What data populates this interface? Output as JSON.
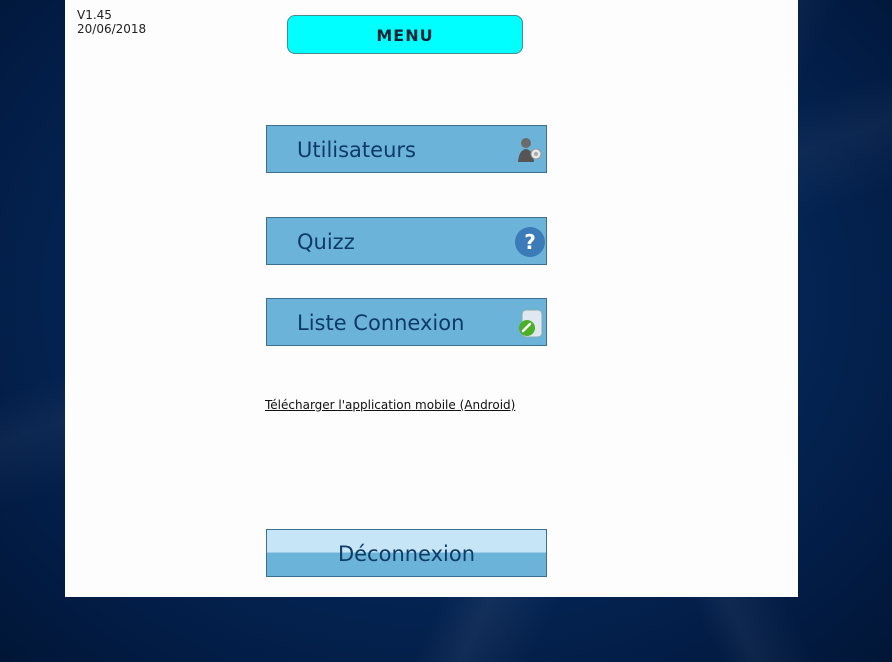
{
  "version": {
    "number": "V1.45",
    "date": "20/06/2018"
  },
  "header": {
    "title": "MENU"
  },
  "menu": {
    "items": [
      {
        "label": "Utilisateurs",
        "icon": "users-icon"
      },
      {
        "label": "Quizz",
        "icon": "question-icon"
      },
      {
        "label": "Liste Connexion",
        "icon": "connection-list-icon"
      }
    ]
  },
  "links": {
    "download": "Télécharger l'application mobile (Android)"
  },
  "actions": {
    "logout": "Déconnexion"
  },
  "colors": {
    "menu_badge": "#00ffff",
    "button": "#6cb3da",
    "button_text": "#0d3b66",
    "background": "#021c45"
  }
}
